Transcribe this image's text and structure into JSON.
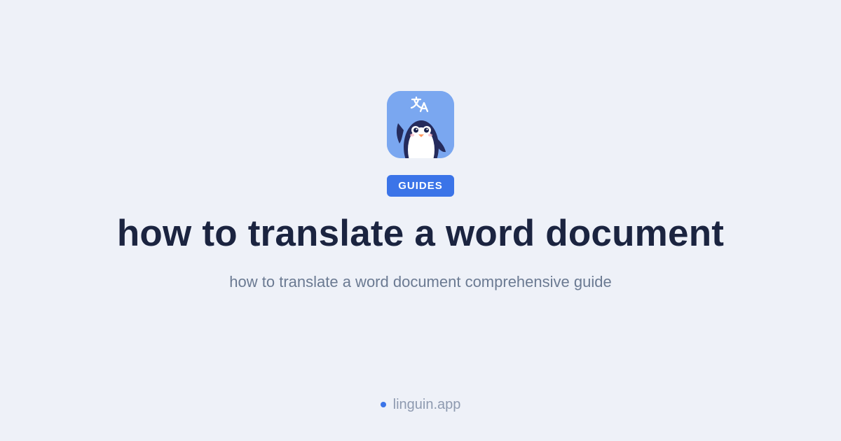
{
  "app": {
    "icon_name": "penguin-translate-icon",
    "translate_symbol_name": "translate-icon",
    "mascot_name": "penguin-mascot"
  },
  "badge": {
    "label": "GUIDES"
  },
  "page": {
    "title": "how to translate a word document",
    "subtitle": "how to translate a word document comprehensive guide"
  },
  "footer": {
    "site": "linguin.app"
  },
  "colors": {
    "background": "#eef1f8",
    "accent": "#3b74e8",
    "title": "#1b2440",
    "subtitle": "#6b7a92",
    "footer_text": "#8e9ab0",
    "icon_background": "#7aa7f0"
  }
}
